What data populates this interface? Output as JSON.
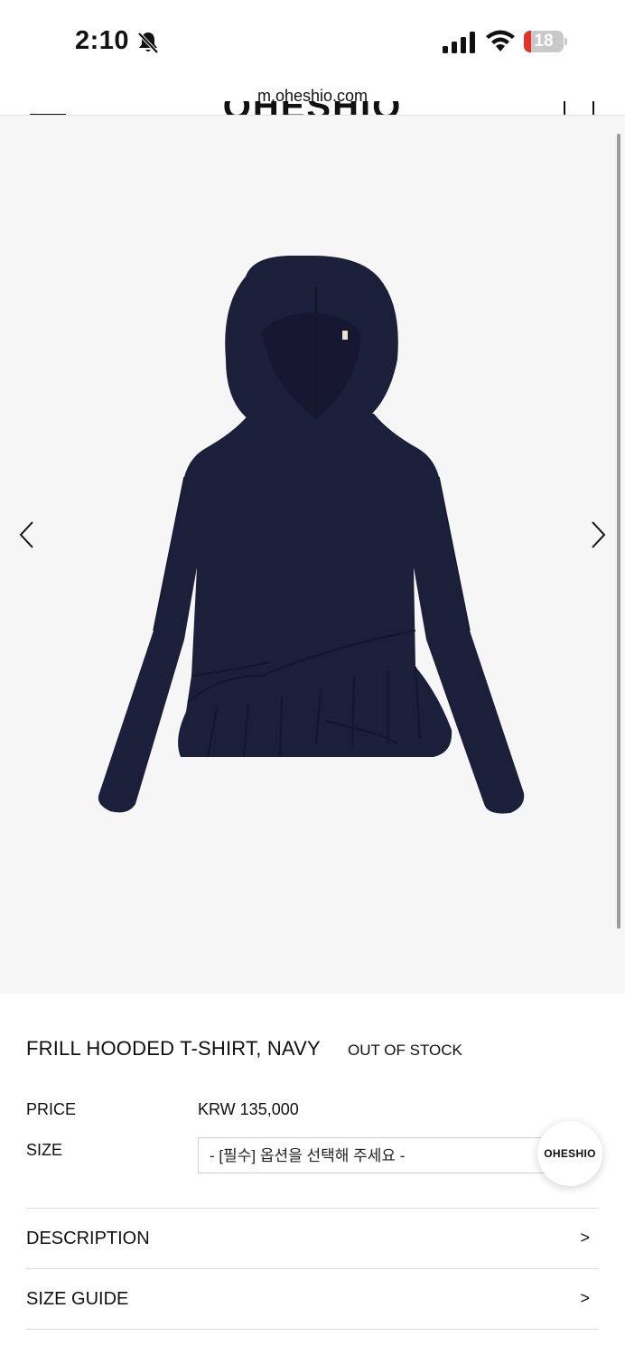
{
  "status_bar": {
    "time": "2:10",
    "battery_level": "18",
    "battery_fraction": 0.18,
    "icons": [
      "bell-slash-icon",
      "cellular-signal-icon",
      "wifi-icon",
      "battery-icon"
    ]
  },
  "browser": {
    "url": "m.oheshio.com"
  },
  "header": {
    "logo": "OHESHIO",
    "icons": [
      "menu-icon",
      "shopping-bag-icon"
    ]
  },
  "gallery": {
    "icons": [
      "chevron-left-icon",
      "chevron-right-icon"
    ],
    "product_color": "#1c1f3a"
  },
  "product": {
    "name": "FRILL HOODED T-SHIRT, NAVY",
    "stock_status": "OUT OF STOCK",
    "price_label": "PRICE",
    "price_value": "KRW 135,000",
    "size_label": "SIZE",
    "size_placeholder": "- [필수] 옵션을 선택해 주세요 -"
  },
  "badge": {
    "label": "OHESHIO"
  },
  "sections": [
    {
      "label": "DESCRIPTION",
      "chevron": ">"
    },
    {
      "label": "SIZE GUIDE",
      "chevron": ">"
    }
  ]
}
